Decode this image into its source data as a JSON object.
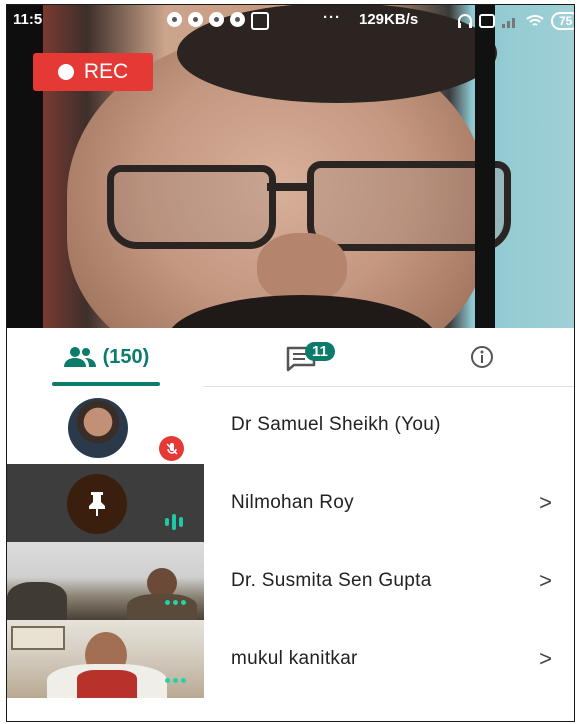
{
  "status_bar": {
    "time": "11:5",
    "more": "···",
    "speed": "129KB/s",
    "battery": "75"
  },
  "recording": {
    "label": "REC"
  },
  "tabs": {
    "people_count": "(150)",
    "chat_unread": "11"
  },
  "participants": [
    {
      "name": "Dr Samuel Sheikh (You)",
      "has_chevron": false
    },
    {
      "name": "Nilmohan Roy",
      "has_chevron": true,
      "chevron": ">"
    },
    {
      "name": "Dr. Susmita Sen Gupta",
      "has_chevron": true,
      "chevron": ">"
    },
    {
      "name": "mukul kanitkar",
      "has_chevron": true,
      "chevron": ">"
    }
  ],
  "colors": {
    "accent": "#0b7b6a",
    "record": "#e53935",
    "speaking": "#1ec8a4"
  },
  "icons": [
    "people-icon",
    "chat-icon",
    "info-icon",
    "mic-off-icon",
    "pin-icon",
    "speaking-icon",
    "more-icon",
    "chevron-right-icon"
  ]
}
